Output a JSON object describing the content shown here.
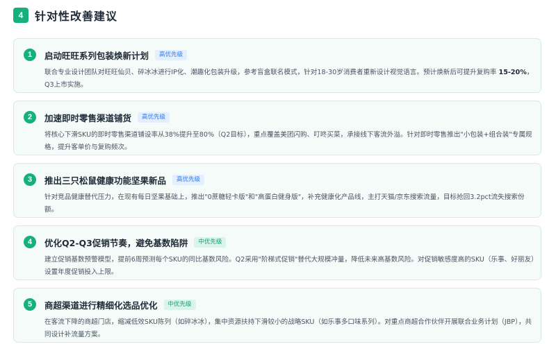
{
  "section": {
    "number": "4",
    "title": "针对性改善建议"
  },
  "cards": [
    {
      "num": "1",
      "title": "启动旺旺系列包装焕新计划",
      "tag": "高优先级",
      "body_pre": "联合专业设计团队对旺旺仙贝、碎冰冰进行IP化、潮趣化包装升级，参考盲盒联名模式，针对18-30岁消费者重新设计视觉语言。预计焕新后可提升复购率 ",
      "body_bold": "15-20%",
      "body_post": "，Q3上市实施。"
    },
    {
      "num": "2",
      "title": "加速即时零售渠道铺货",
      "tag": "高优先级",
      "body": "将核心下滑SKU的即时零售渠道铺设率从38%提升至80%（Q2目标），重点覆盖美团闪购、叮咚买菜，承接线下客流外溢。针对即时零售推出\"小包装+组合装\"专属规格，提升客单价与复购频次。"
    },
    {
      "num": "3",
      "title": "推出三只松鼠健康功能坚果新品",
      "tag": "高优先级",
      "body": "针对竞品健康替代压力，在现有每日坚果基础上，推出\"0蔗糖轻卡版\"和\"高蛋白健身版\"，补充健康化产品线，主打天猫/京东搜索流量，目标抢回3.2pct流失搜索份额。"
    },
    {
      "num": "4",
      "title": "优化Q2-Q3促销节奏，避免基数陷阱",
      "tag": "中优先级",
      "body": "建立促销基数预警模型，提前6周预测每个SKU的同比基数风险。Q2采用\"阶梯式促销\"替代大规模冲量，降低未来高基数风险。对促销敏感度高的SKU（乐事、好丽友）设置年度促销投入上限。"
    },
    {
      "num": "5",
      "title": "商超渠道进行精细化选品优化",
      "tag": "中优先级",
      "body": "在客流下降的商超门店，缩减低效SKU陈列（如碎冰冰），集中资源扶持下滑较小的战略SKU（如乐事多口味系列）。对重点商超合作伙伴开展联合业务计划（JBP），共同设计补流量方案。"
    }
  ],
  "colors": {
    "accent": "#16b07e",
    "card_bg": "#f4fbf9",
    "tag_high_bg": "#e3efff",
    "tag_high_text": "#2f7be8",
    "tag_mid_bg": "#d9f4ea",
    "tag_mid_text": "#14a271"
  }
}
